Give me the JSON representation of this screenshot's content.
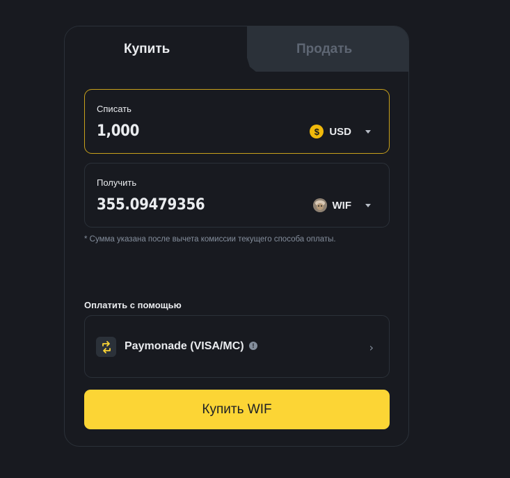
{
  "tabs": {
    "buy": "Купить",
    "sell": "Продать"
  },
  "spend": {
    "label": "Списать",
    "value": "1,000",
    "currency": "USD",
    "currency_icon": "dollar-coin-icon"
  },
  "receive": {
    "label": "Получить",
    "value": "355.09479356",
    "currency": "WIF",
    "currency_icon": "wif-coin-icon"
  },
  "note": "* Сумма указана после вычета комиссии текущего способа оплаты.",
  "payment": {
    "label": "Оплатить с помощью",
    "method": "Paymonade (VISA/MC)",
    "info_icon": "info-icon",
    "chevron_icon": "chevron-right-icon"
  },
  "buy_button": "Купить WIF",
  "colors": {
    "background": "#181a20",
    "accent": "#fcd535",
    "active_border": "#c9a21b",
    "muted_text": "#848e9c",
    "sell_tab_bg": "#2b3139"
  }
}
